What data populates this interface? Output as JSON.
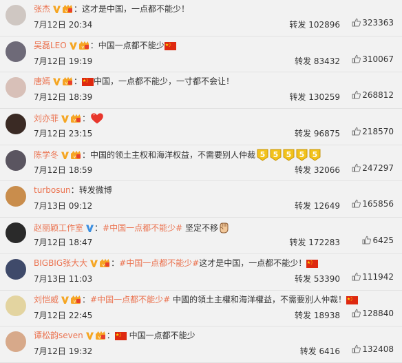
{
  "accent_color": "#eb7350",
  "posts": [
    {
      "username": "张杰",
      "badges": [
        "v",
        "crown"
      ],
      "segments": [
        {
          "kind": "colon",
          "text": "："
        },
        {
          "kind": "text",
          "text": "这才是中国，一点都不能少！"
        }
      ],
      "time": "7月12日 20:34",
      "reposts_label": "转发 102896",
      "likes": "323363",
      "avatar_color": "#cfc7c2"
    },
    {
      "username": "吴磊LEO",
      "badges": [
        "v",
        "crown"
      ],
      "segments": [
        {
          "kind": "colon",
          "text": "："
        },
        {
          "kind": "text",
          "text": "中国一点都不能少"
        },
        {
          "kind": "flag"
        }
      ],
      "time": "7月12日 19:19",
      "reposts_label": "转发 83432",
      "likes": "310067",
      "avatar_color": "#6e6a78"
    },
    {
      "username": "唐嫣",
      "badges": [
        "v",
        "crown"
      ],
      "segments": [
        {
          "kind": "colon",
          "text": "："
        },
        {
          "kind": "flag"
        },
        {
          "kind": "text",
          "text": "中国，一点都不能少，一寸都不会让！"
        }
      ],
      "time": "7月12日 18:39",
      "reposts_label": "转发 130259",
      "likes": "268812",
      "avatar_color": "#d8c0b8"
    },
    {
      "username": "刘亦菲",
      "badges": [
        "v",
        "crown"
      ],
      "segments": [
        {
          "kind": "colon",
          "text": "："
        },
        {
          "kind": "heart"
        }
      ],
      "time": "7月12日 23:15",
      "reposts_label": "转发 96875",
      "likes": "218570",
      "avatar_color": "#3a2a24"
    },
    {
      "username": "陈学冬",
      "badges": [
        "v",
        "crown"
      ],
      "segments": [
        {
          "kind": "colon",
          "text": "："
        },
        {
          "kind": "text",
          "text": "中国的领土主权和海洋权益，不需要别人仲裁"
        },
        {
          "kind": "fives"
        }
      ],
      "time": "7月12日 18:59",
      "reposts_label": "转发 32066",
      "likes": "247297",
      "avatar_color": "#5a5560"
    },
    {
      "username": "turbosun",
      "badges": [],
      "segments": [
        {
          "kind": "colon",
          "text": "："
        },
        {
          "kind": "text",
          "text": "转发微博"
        }
      ],
      "time": "7月13日 09:12",
      "reposts_label": "转发 12649",
      "likes": "165856",
      "avatar_color": "#c98d4c"
    },
    {
      "username": "赵丽颖工作室",
      "badges": [
        "vblue"
      ],
      "segments": [
        {
          "kind": "colon",
          "text": "："
        },
        {
          "kind": "topic",
          "text": "#中国一点都不能少#"
        },
        {
          "kind": "text",
          "text": " 坚定不移"
        },
        {
          "kind": "fist"
        }
      ],
      "time": "7月12日 18:47",
      "reposts_label": "转发 172283",
      "likes": "6425",
      "avatar_color": "#2a2a2a"
    },
    {
      "username": "BIGBIG张大大",
      "badges": [
        "v",
        "crown"
      ],
      "segments": [
        {
          "kind": "colon",
          "text": "："
        },
        {
          "kind": "topic",
          "text": "#中国一点都不能少#"
        },
        {
          "kind": "text",
          "text": "这才是中国，一点都不能少！"
        },
        {
          "kind": "flag"
        }
      ],
      "time": "7月13日 11:03",
      "reposts_label": "转发 53390",
      "likes": "111942",
      "avatar_color": "#3f4a6a"
    },
    {
      "username": "刘恺威",
      "badges": [
        "v",
        "crown"
      ],
      "segments": [
        {
          "kind": "colon",
          "text": "："
        },
        {
          "kind": "topic",
          "text": "#中国一点都不能少#"
        },
        {
          "kind": "text",
          "text": " 中國的領土主權和海洋權益，不需要別人仲裁！"
        },
        {
          "kind": "flag"
        }
      ],
      "time": "7月12日 22:45",
      "reposts_label": "转发 18938",
      "likes": "128840",
      "avatar_color": "#e3d4a0"
    },
    {
      "username": "谭松韵seven",
      "badges": [
        "v",
        "crown"
      ],
      "segments": [
        {
          "kind": "colon",
          "text": "："
        },
        {
          "kind": "flag"
        },
        {
          "kind": "text",
          "text": " 中国一点都不能少"
        }
      ],
      "time": "7月12日 19:32",
      "reposts_label": "转发 6416",
      "likes": "132408",
      "avatar_color": "#d7a98a"
    }
  ]
}
